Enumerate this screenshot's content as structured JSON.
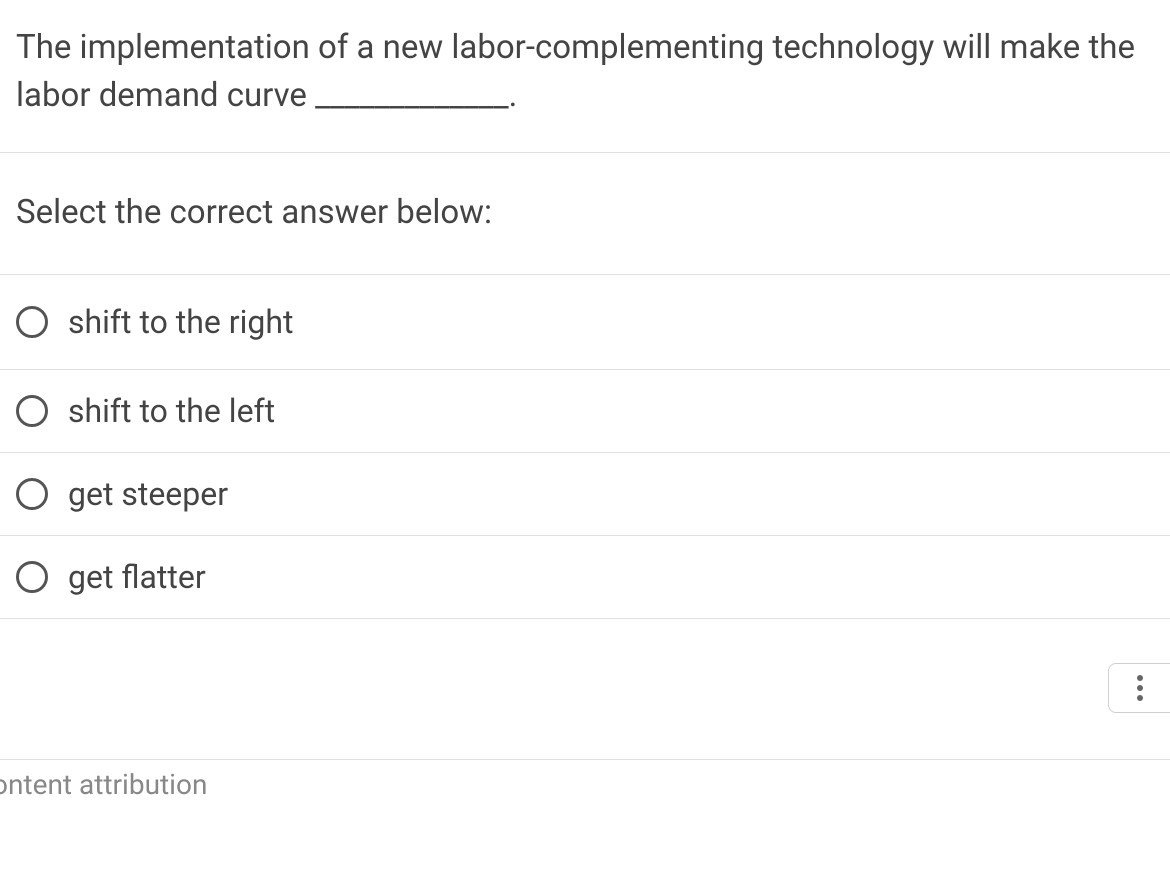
{
  "question": {
    "text": "The implementation of a new labor-complementing technology will make the labor demand curve _____________."
  },
  "instruction": "Select the correct answer below:",
  "options": [
    {
      "label": "shift to the right"
    },
    {
      "label": "shift to the left"
    },
    {
      "label": "get steeper"
    },
    {
      "label": "get flatter"
    }
  ],
  "footer": {
    "attribution": "ontent attribution"
  }
}
